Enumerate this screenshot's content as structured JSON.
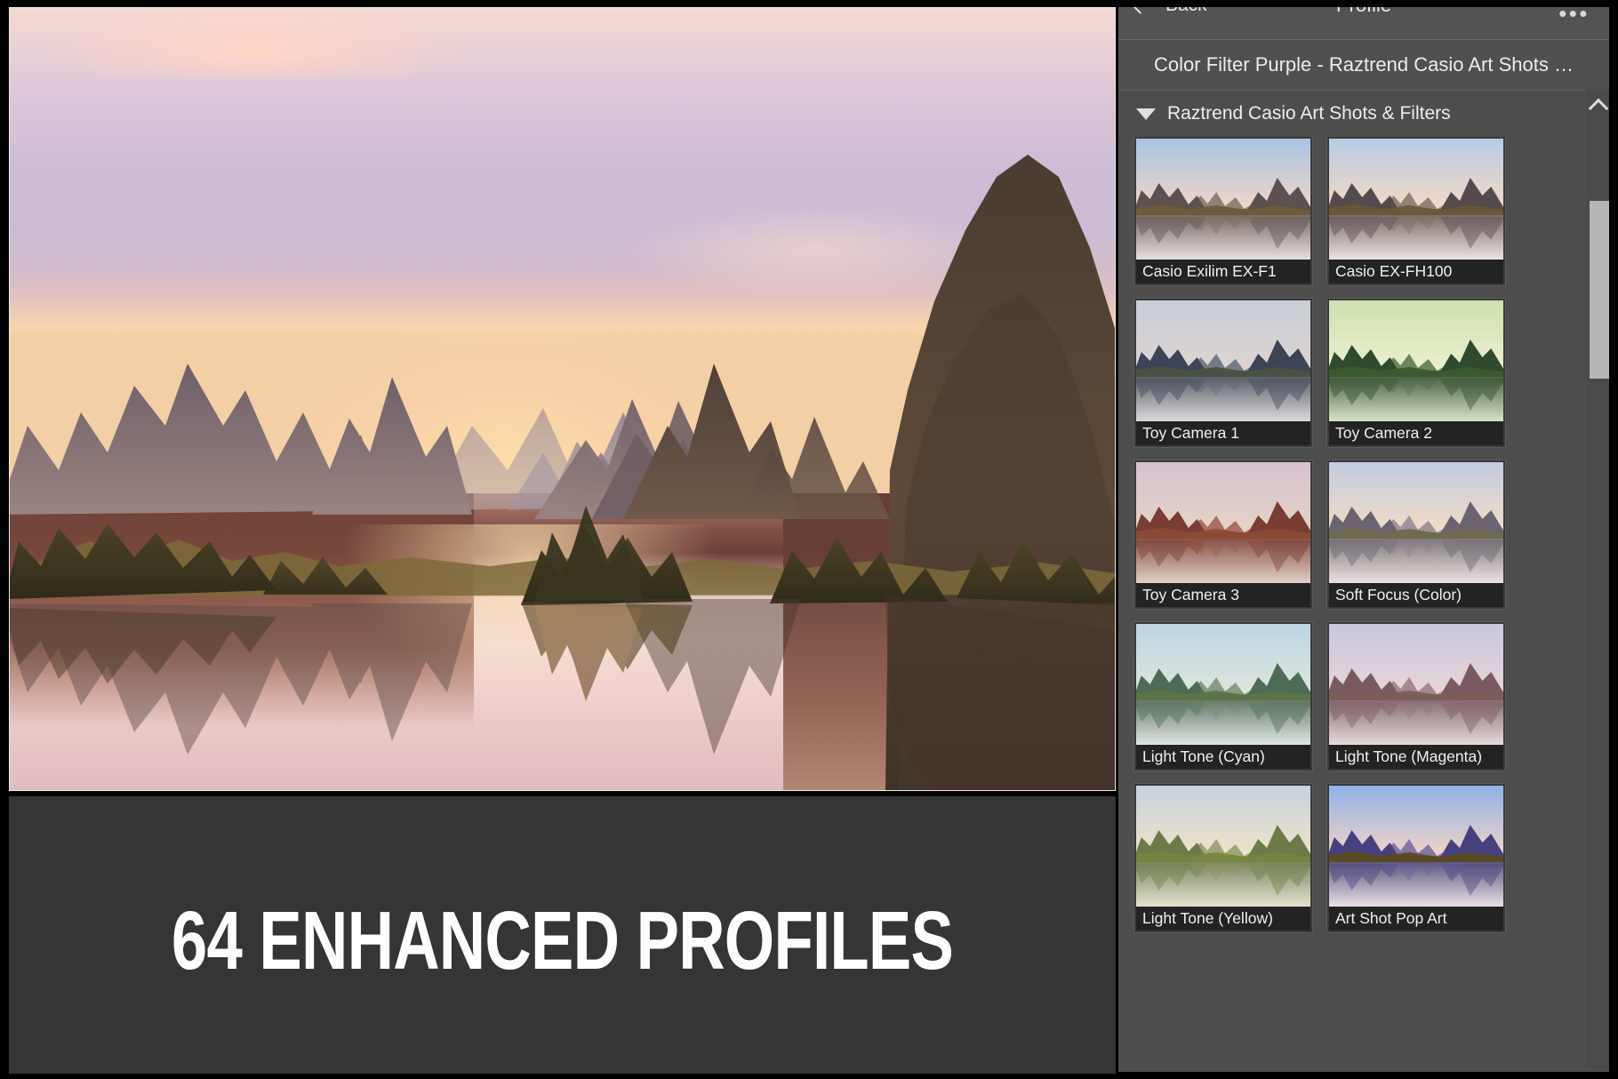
{
  "app": {
    "panel": {
      "back_label": "Back",
      "title": "Profile",
      "more_label": "•••",
      "current_profile": "Color Filter Purple - Raztrend Casio Art Shots …",
      "group_label": "Raztrend Casio Art Shots & Filters"
    },
    "caption": "64 ENHANCED PROFILES",
    "profiles": [
      {
        "label": "Casio Exilim EX-F1",
        "sky_top": "#a8c4e2",
        "sky_bot": "#f1d6c8",
        "mtn": "#5a5150",
        "mtn2": "#7b6b62",
        "fg": "#6d5a3a",
        "water_top": "#6a5c55",
        "water_bot": "#e6dfe0"
      },
      {
        "label": "Casio EX-FH100",
        "sky_top": "#b7cbe6",
        "sky_bot": "#f4d9c4",
        "mtn": "#544b4c",
        "mtn2": "#7d6b63",
        "fg": "#6a5738",
        "water_top": "#6b5d57",
        "water_bot": "#ece3e2"
      },
      {
        "label": "Toy Camera 1",
        "sky_top": "#c8cfd6",
        "sky_bot": "#ded4d2",
        "mtn": "#3c4455",
        "mtn2": "#5d6476",
        "fg": "#4a5140",
        "water_top": "#4a5059",
        "water_bot": "#dcdadb"
      },
      {
        "label": "Toy Camera 2",
        "sky_top": "#cfe0b0",
        "sky_bot": "#eaf0cf",
        "mtn": "#2f4a2c",
        "mtn2": "#4e6b3f",
        "fg": "#3c5a2e",
        "water_top": "#3a5134",
        "water_bot": "#d8e3c6"
      },
      {
        "label": "Toy Camera 3",
        "sky_top": "#d6c2cf",
        "sky_bot": "#e6d3c6",
        "mtn": "#7a3d33",
        "mtn2": "#9a584a",
        "fg": "#8a4a36",
        "water_top": "#7c4236",
        "water_bot": "#e2cfc6"
      },
      {
        "label": "Soft Focus (Color)",
        "sky_top": "#c2cbe0",
        "sky_bot": "#f3dcc5",
        "mtn": "#6b6370",
        "mtn2": "#8b8190",
        "fg": "#6e6a4e",
        "water_top": "#6f6a6c",
        "water_bot": "#ece2e2"
      },
      {
        "label": "Light Tone (Cyan)",
        "sky_top": "#bdd6e2",
        "sky_bot": "#dfe5dd",
        "mtn": "#4d6b56",
        "mtn2": "#6f8a6c",
        "fg": "#5d7348",
        "water_top": "#5a6c5c",
        "water_bot": "#dfe6e1"
      },
      {
        "label": "Light Tone (Magenta)",
        "sky_top": "#c9c6dd",
        "sky_bot": "#e7d6d8",
        "mtn": "#7a5a60",
        "mtn2": "#95767c",
        "fg": "#7b5d5a",
        "water_top": "#7a5f62",
        "water_bot": "#e8dadb"
      },
      {
        "label": "Light Tone (Yellow)",
        "sky_top": "#c6d2dc",
        "sky_bot": "#f0e3c9",
        "mtn": "#6d7b4a",
        "mtn2": "#8a9660",
        "fg": "#77853f",
        "water_top": "#6f7a52",
        "water_bot": "#e5e3cf"
      },
      {
        "label": "Art Shot Pop Art",
        "sky_top": "#8fb2e8",
        "sky_bot": "#f2d4c6",
        "mtn": "#47407e",
        "mtn2": "#6a5f9e",
        "fg": "#5a4a20",
        "water_top": "#4b4670",
        "water_bot": "#e9e0e6"
      }
    ],
    "icons": {
      "back": "arrow-left-icon",
      "more": "overflow-menu-icon",
      "group_toggle": "triangle-down-icon",
      "scroll_up": "chevron-up-icon"
    },
    "colors": {
      "panel_bg": "#4d4d4d",
      "header_bg": "#535353",
      "caption_bg": "#353535",
      "caption_fg": "#ffffff",
      "thumb_caption_bg": "#232323",
      "scroll_thumb": "#b6b6b6"
    }
  }
}
